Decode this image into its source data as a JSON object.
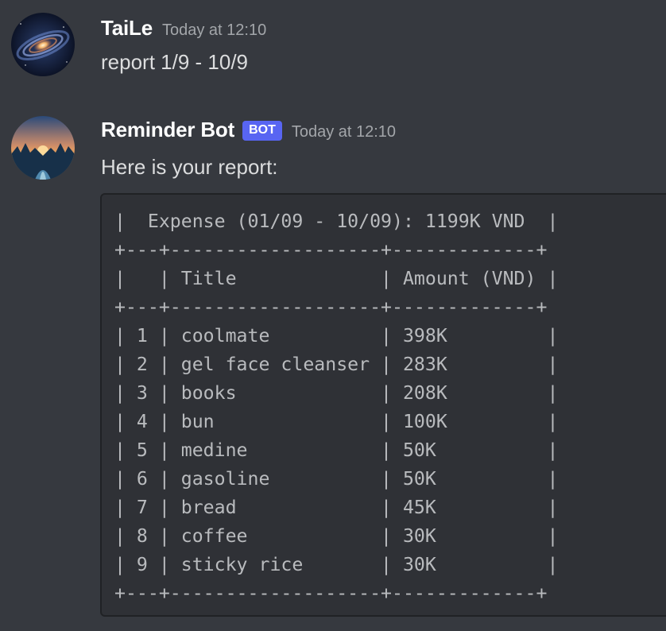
{
  "messages": [
    {
      "username": "TaiLe",
      "timestamp": "Today at 12:10",
      "content": "report 1/9 - 10/9"
    },
    {
      "username": "Reminder Bot",
      "badge": "BOT",
      "timestamp": "Today at 12:10",
      "content": "Here is your report:",
      "code_lines": [
        "|  Expense (01/09 - 10/09): 1199K VND  |",
        "+---+-------------------+-------------+",
        "|   | Title             | Amount (VND) |",
        "+---+-------------------+-------------+",
        "| 1 | coolmate          | 398K         |",
        "| 2 | gel face cleanser | 283K         |",
        "| 3 | books             | 208K         |",
        "| 4 | bun               | 100K         |",
        "| 5 | medine            | 50K          |",
        "| 6 | gasoline          | 50K          |",
        "| 7 | bread             | 45K          |",
        "| 8 | coffee            | 30K          |",
        "| 9 | sticky rice       | 30K          |",
        "+---+-------------------+-------------+"
      ]
    }
  ],
  "colors": {
    "background": "#36393f",
    "codeblock_bg": "#2f3136",
    "bot_badge": "#5865f2",
    "username": "#ffffff",
    "text": "#dcddde",
    "timestamp": "#a3a6aa"
  },
  "icons": {
    "user_avatar": "galaxy-avatar-icon",
    "bot_avatar": "sunset-landscape-avatar-icon"
  }
}
